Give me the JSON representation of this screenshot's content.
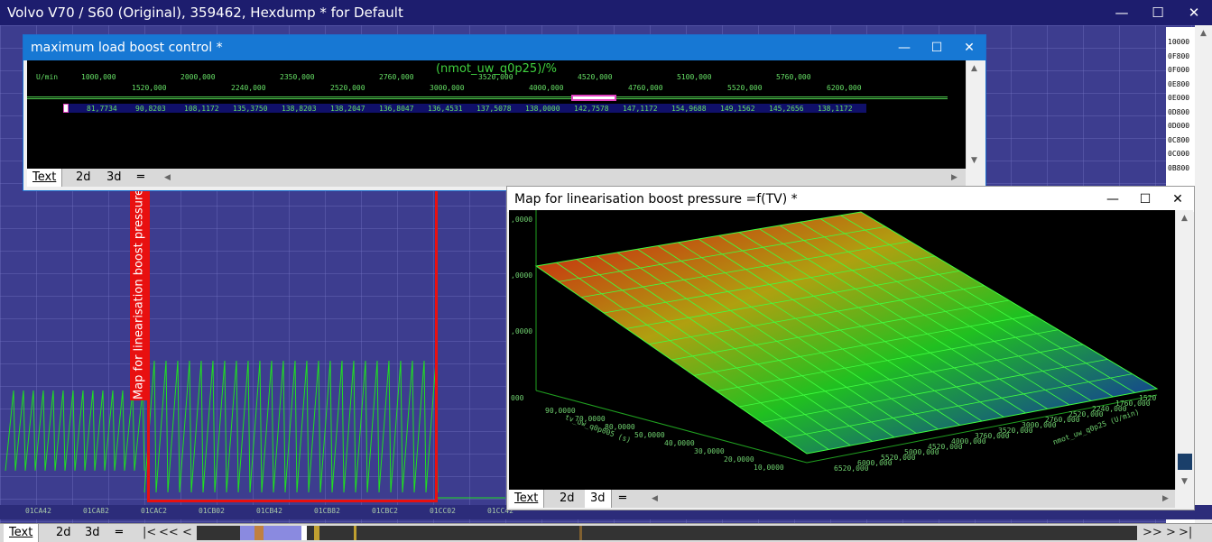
{
  "app": {
    "title": "Volvo V70 / S60 (Original), 359462, Hexdump * for Default"
  },
  "window_controls": {
    "minimize": "—",
    "maximize": "☐",
    "close": "✕"
  },
  "hex_plot": {
    "axis_labels": [
      "01CA42",
      "01CA82",
      "01CAC2",
      "01CB02",
      "01CB42",
      "01CB82",
      "01CBC2",
      "01CC02",
      "01CC42"
    ],
    "right_addresses": [
      "10000",
      "0F800",
      "0F000",
      "0E800",
      "0E000",
      "0D800",
      "0D000",
      "0C800",
      "0C000",
      "0B800"
    ],
    "highlight_label": "Map for linearisation boost pressure"
  },
  "bottom_tabs": {
    "text": "Text",
    "d2": "2d",
    "d3": "3d",
    "menu": "═"
  },
  "bottom_nav": {
    "first": "|<",
    "prev": "<<",
    "back": "<",
    "next": ">>",
    "fwd": ">",
    "last": ">|"
  },
  "boost_window": {
    "title": "maximum load boost control *",
    "axis_title": "(nmot_uw_q0p25)/%",
    "unit_label": "U/min",
    "x_top": [
      "1000,000",
      "2000,000",
      "2350,000",
      "2760,000",
      "3520,000",
      "4520,000",
      "5100,000",
      "5760,000"
    ],
    "x_bottom": [
      "1520,000",
      "2240,000",
      "2520,000",
      "3000,000",
      "4000,000",
      "4760,000",
      "5520,000",
      "6200,000"
    ],
    "values": [
      "81,7734",
      "90,8203",
      "108,1172",
      "135,3750",
      "138,8203",
      "138,2047",
      "136,8047",
      "136,4531",
      "137,5078",
      "138,0000",
      "142,7578",
      "147,1172",
      "154,9688",
      "149,1562",
      "145,2656",
      "138,1172"
    ],
    "tabs": {
      "text": "Text",
      "d2": "2d",
      "d3": "3d",
      "menu": "═"
    }
  },
  "map_window": {
    "title": "Map for linearisation boost pressure =f(TV) *",
    "z_labels": [
      ",0000",
      ",0000",
      ",0000",
      "000"
    ],
    "y_labels": [
      "90,0000",
      "70,0000",
      "80,0000",
      "50,0000",
      "40,0000",
      "30,0000",
      "20,0000",
      "10,0000"
    ],
    "y_axis_name": "tv_uw_q0p005 (s)",
    "x_labels": [
      "6520,000",
      "6000,000",
      "5520,000",
      "5000,000",
      "4520,000",
      "4000,000",
      "3760,000",
      "3520,000",
      "3000,000",
      "2760,000",
      "2520,000",
      "2240,000",
      "1760,000",
      "1520"
    ],
    "x_axis_name": "nmot_uw_q0p25 (U/min)",
    "tabs": {
      "text": "Text",
      "d2": "2d",
      "d3": "3d",
      "menu": "═"
    }
  },
  "colors": {
    "accent": "#1778d4",
    "plot_bg": "#3d3d8f",
    "signal": "#20e020",
    "highlight": "#e81010"
  }
}
